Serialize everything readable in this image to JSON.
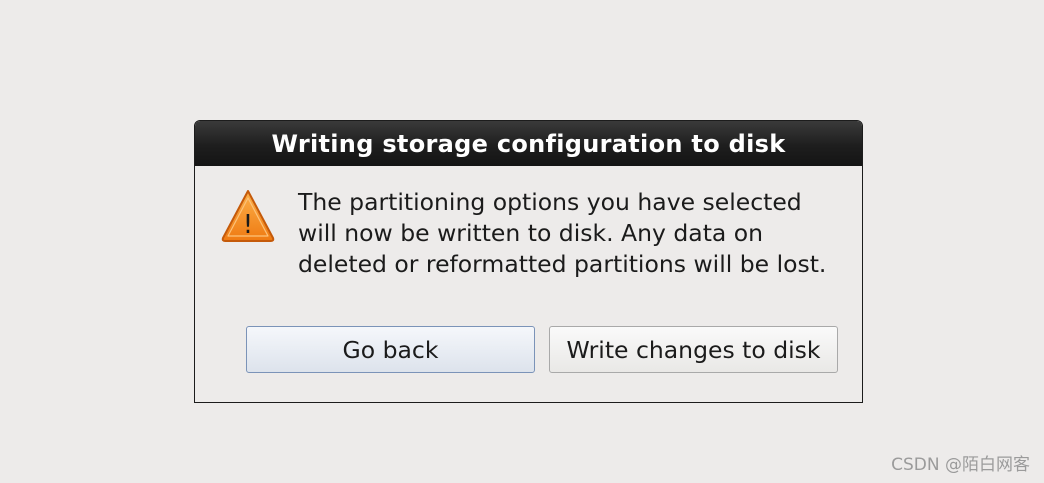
{
  "dialog": {
    "title": "Writing storage configuration to disk",
    "icon": "warning-icon",
    "message": "The partitioning options you have selected\nwill now be written to disk.  Any data on\ndeleted or reformatted partitions will be lost.",
    "buttons": {
      "go_back": "Go back",
      "write_changes": "Write changes to disk"
    }
  },
  "watermark": "CSDN @陌白网客",
  "colors": {
    "background": "#edebea",
    "titlebar": "#1e1e1e",
    "warning_fill": "#f5891f",
    "default_button_border": "#7b93b8"
  }
}
